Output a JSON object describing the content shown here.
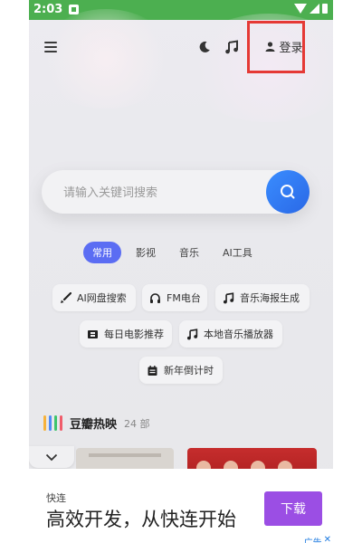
{
  "statusbar": {
    "time": "2:03"
  },
  "topbar": {
    "login_label": "登录"
  },
  "search": {
    "placeholder": "请输入关键词搜索"
  },
  "categories": [
    "常用",
    "影视",
    "音乐",
    "AI工具"
  ],
  "tools": [
    "AI网盘搜索",
    "FM电台",
    "音乐海报生成",
    "每日电影推荐",
    "本地音乐播放器",
    "新年倒计时"
  ],
  "section": {
    "title": "豆瓣热映",
    "count": "24 部",
    "bar_colors": [
      "#f6b23c",
      "#4f8df7",
      "#3ec46d",
      "#f05c6a"
    ]
  },
  "ad": {
    "brand": "快连",
    "headline": "高效开发，从快连开始",
    "button": "下载",
    "tag": "广告"
  },
  "colors": {
    "statusbar": "#4caf50",
    "accent": "#2a68e6",
    "category_active": "#5b6df3",
    "ad_button": "#9b4ee4",
    "highlight_box": "#e53935"
  }
}
